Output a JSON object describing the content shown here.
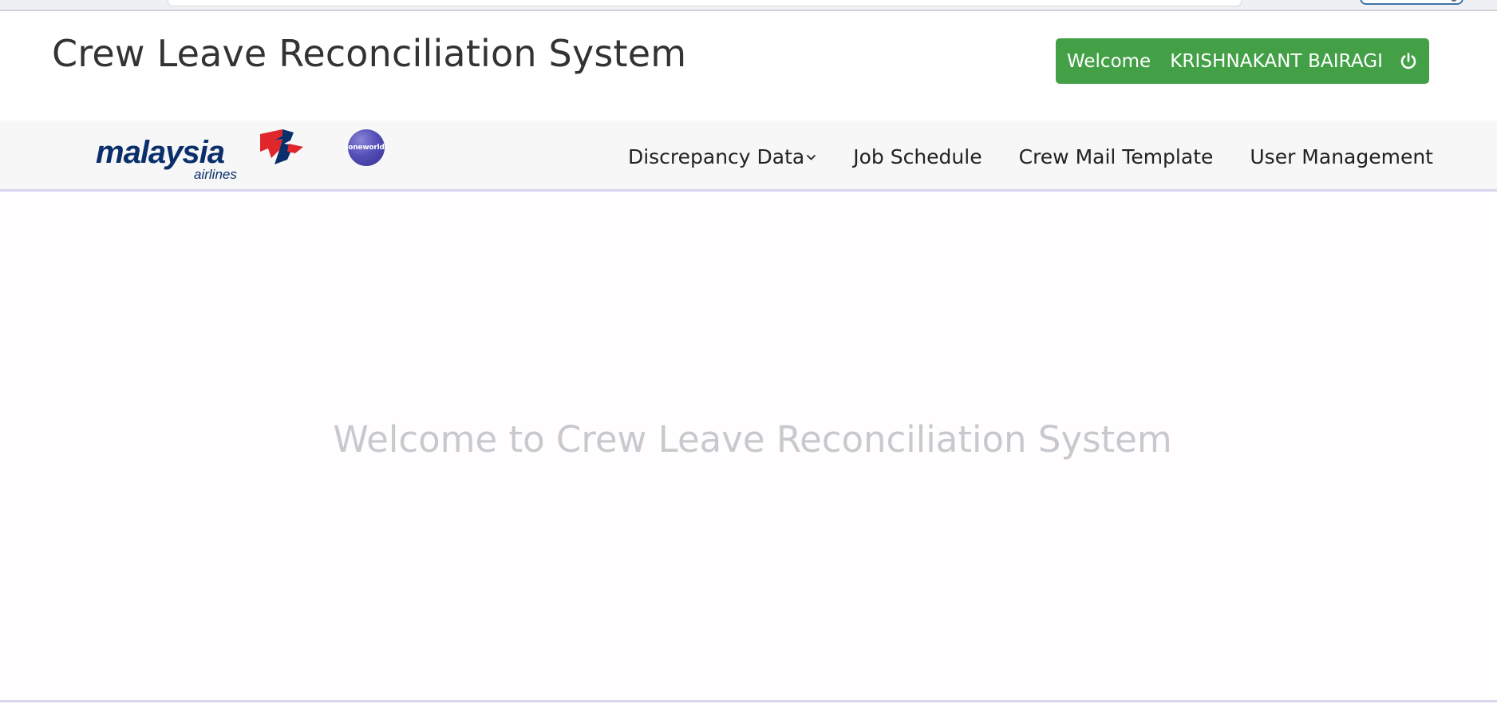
{
  "header": {
    "title": "Crew Leave Reconciliation System",
    "welcome_label": "Welcome",
    "user_name": "KRISHNAKANT BAIRAGI",
    "logout_icon": "power-icon"
  },
  "brand": {
    "logo_text": "malaysia",
    "logo_subtext": "airlines",
    "alliance_badge": "oneworld",
    "colors": {
      "accent_green": "#43a047",
      "logo_blue": "#0a2f6b",
      "logo_red": "#e0262b",
      "alliance_purple": "#5550b8"
    }
  },
  "nav": {
    "items": [
      {
        "label": "Discrepancy Data",
        "has_dropdown": true
      },
      {
        "label": "Job Schedule"
      },
      {
        "label": "Crew Mail Template"
      },
      {
        "label": "User Management"
      }
    ]
  },
  "main": {
    "welcome_message": "Welcome to Crew Leave Reconciliation System"
  }
}
